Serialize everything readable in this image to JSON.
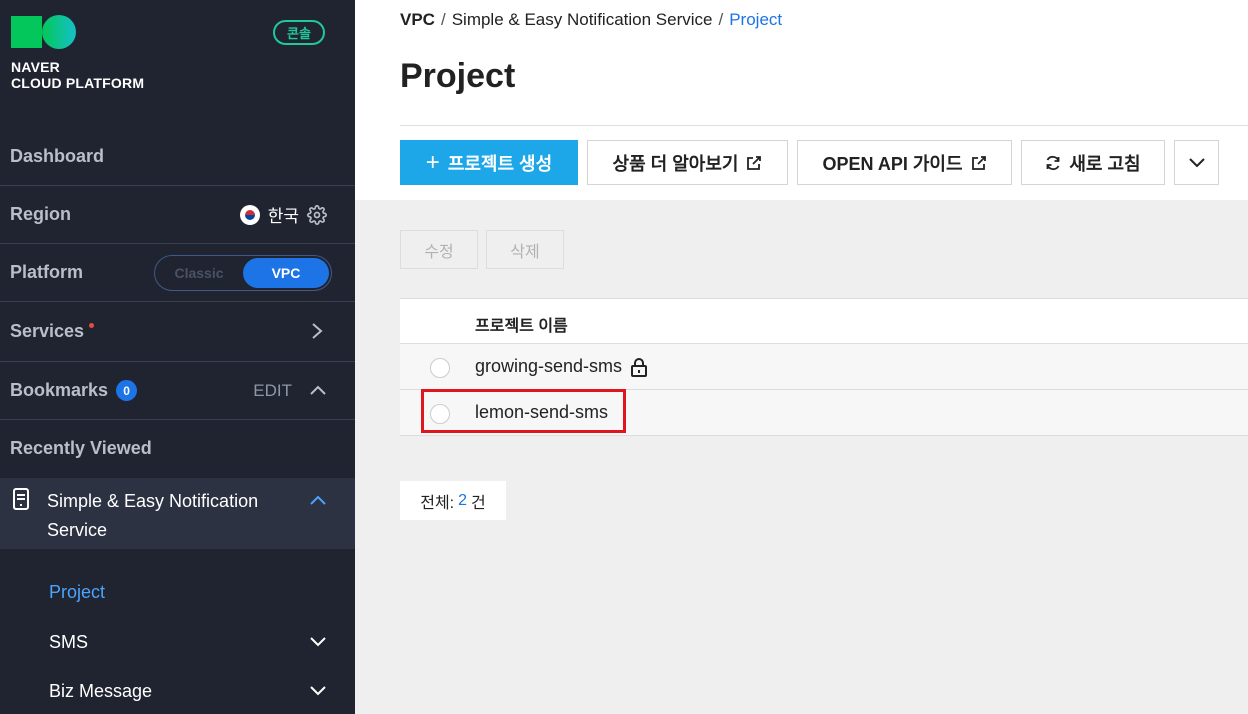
{
  "brand": {
    "line1": "NAVER",
    "line2": "CLOUD PLATFORM",
    "console_badge": "콘솔"
  },
  "sidebar": {
    "dashboard": "Dashboard",
    "region": {
      "label": "Region",
      "value": "한국"
    },
    "platform": {
      "label": "Platform",
      "options": [
        "Classic",
        "VPC"
      ],
      "selected": "VPC"
    },
    "services": "Services",
    "bookmarks": {
      "label": "Bookmarks",
      "count": "0",
      "edit": "EDIT"
    },
    "recently_viewed": "Recently Viewed",
    "service_group": {
      "title": "Simple & Easy Notification Service",
      "items": [
        "Project",
        "SMS",
        "Biz Message"
      ]
    }
  },
  "breadcrumb": [
    "VPC",
    "Simple & Easy Notification Service",
    "Project"
  ],
  "breadcrumb_sep": "/",
  "page_title": "Project",
  "toolbar": {
    "create": "프로젝트 생성",
    "create_icon": "+",
    "learn_more": "상품 더 알아보기",
    "api_guide": "OPEN API 가이드",
    "refresh": "새로 고침"
  },
  "actions": {
    "edit": "수정",
    "delete": "삭제"
  },
  "table": {
    "header": "프로젝트 이름",
    "rows": [
      {
        "name": "growing-send-sms",
        "locked": true
      },
      {
        "name": "lemon-send-sms",
        "locked": false
      }
    ]
  },
  "total": {
    "prefix": "전체:",
    "count": "2",
    "suffix": "건"
  },
  "colors": {
    "accent": "#1c74e6",
    "create_button": "#1ea7e8",
    "highlight": "#e0161f",
    "sidebar_bg": "#1f2430"
  }
}
